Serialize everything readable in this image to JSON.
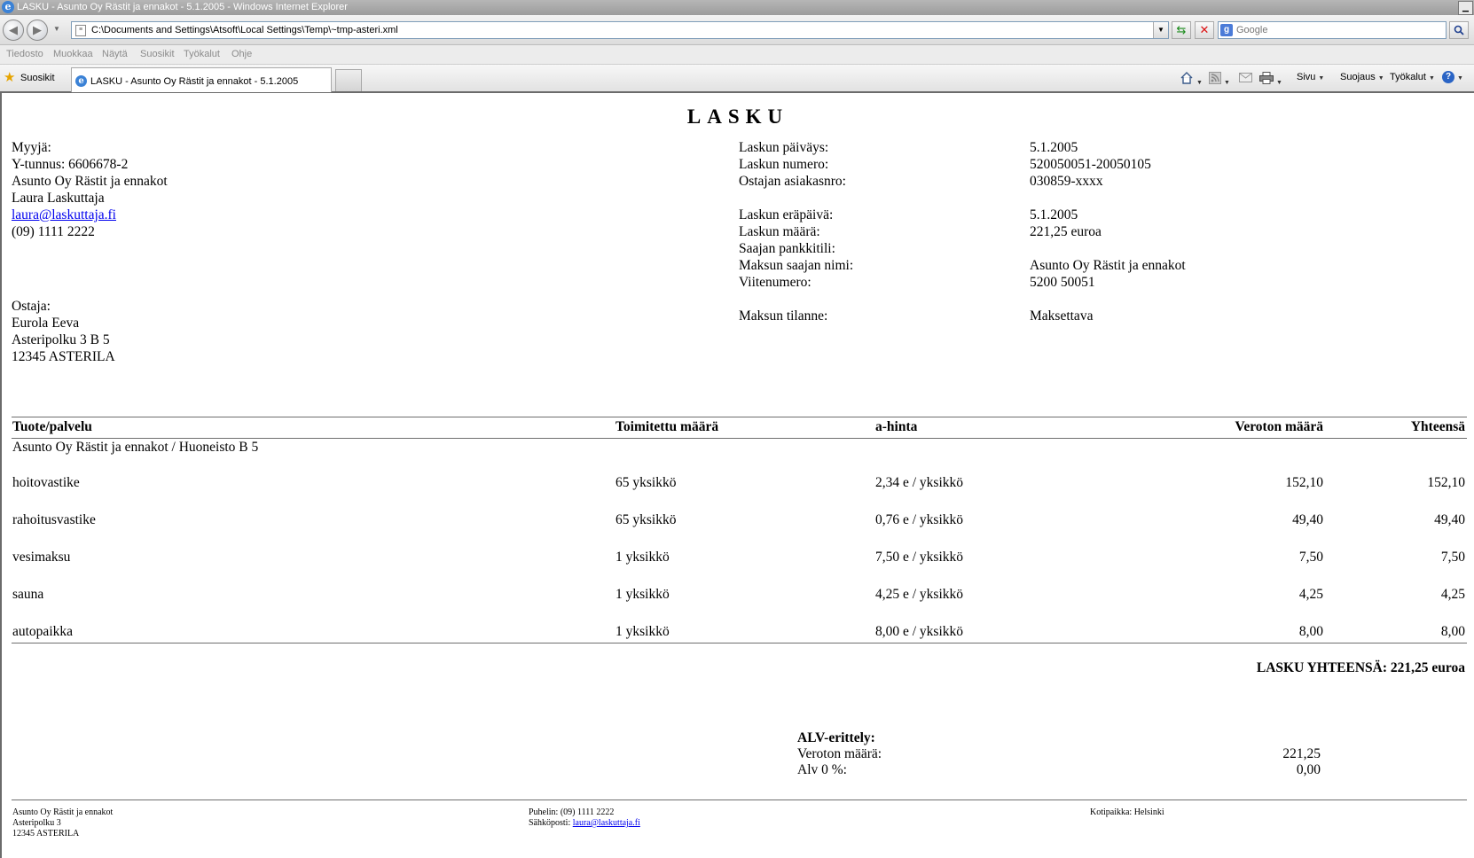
{
  "browser": {
    "window_title": "LASKU - Asunto Oy Rästit ja ennakot - 5.1.2005 - Windows Internet Explorer",
    "address": "C:\\Documents and Settings\\Atsoft\\Local Settings\\Temp\\~tmp-asteri.xml",
    "search_placeholder": "Google",
    "menu": [
      "Tiedosto",
      "Muokkaa",
      "Näytä",
      "Suosikit",
      "Työkalut",
      "Ohje"
    ],
    "favorites_label": "Suosikit",
    "tab_title": "LASKU - Asunto Oy Rästit ja ennakot - 5.1.2005",
    "commands": {
      "page": "Sivu",
      "security": "Suojaus",
      "tools": "Työkalut"
    }
  },
  "invoice": {
    "title": "LASKU",
    "seller": {
      "heading": "Myyjä:",
      "business_id": "Y-tunnus: 6606678-2",
      "company": "Asunto Oy Rästit ja ennakot",
      "person": "Laura Laskuttaja",
      "email": "laura@laskuttaja.fi",
      "phone": "(09) 1111 2222"
    },
    "buyer": {
      "heading": "Ostaja:",
      "name": "Eurola Eeva",
      "street": "Asteripolku 3 B 5",
      "postal": "12345 ASTERILA"
    },
    "details": [
      {
        "label": "Laskun päiväys:",
        "value": "5.1.2005"
      },
      {
        "label": "Laskun numero:",
        "value": "520050051-20050105"
      },
      {
        "label": "Ostajan asiakasnro:",
        "value": "030859-xxxx"
      },
      {
        "label": "Laskun eräpäivä:",
        "value": "5.1.2005"
      },
      {
        "label": "Laskun määrä:",
        "value": "221,25 euroa"
      },
      {
        "label": "Saajan pankkitili:",
        "value": ""
      },
      {
        "label": "Maksun saajan nimi:",
        "value": "Asunto Oy Rästit ja ennakot"
      },
      {
        "label": "Viitenumero:",
        "value": "5200 50051"
      },
      {
        "label": "Maksun tilanne:",
        "value": "Maksettava"
      }
    ],
    "table": {
      "headers": {
        "product": "Tuote/palvelu",
        "quantity": "Toimitettu määrä",
        "unit_price": "a-hinta",
        "net": "Veroton määrä",
        "total": "Yhteensä"
      },
      "group_label": "Asunto Oy Rästit ja ennakot / Huoneisto B 5",
      "rows": [
        {
          "product": "hoitovastike",
          "quantity": "65 yksikkö",
          "unit_price": "2,34 e / yksikkö",
          "net": "152,10",
          "total": "152,10"
        },
        {
          "product": "rahoitusvastike",
          "quantity": "65 yksikkö",
          "unit_price": "0,76 e / yksikkö",
          "net": "49,40",
          "total": "49,40"
        },
        {
          "product": "vesimaksu",
          "quantity": "1 yksikkö",
          "unit_price": "7,50 e / yksikkö",
          "net": "7,50",
          "total": "7,50"
        },
        {
          "product": "sauna",
          "quantity": "1 yksikkö",
          "unit_price": "4,25 e / yksikkö",
          "net": "4,25",
          "total": "4,25"
        },
        {
          "product": "autopaikka",
          "quantity": "1 yksikkö",
          "unit_price": "8,00 e / yksikkö",
          "net": "8,00",
          "total": "8,00"
        }
      ]
    },
    "grand_total": "LASKU YHTEENSÄ: 221,25 euroa",
    "vat": {
      "heading": "ALV-erittely:",
      "net_label": "Veroton määrä:",
      "net_value": "221,25",
      "vat_label": "Alv 0 %:",
      "vat_value": "0,00"
    },
    "footer": {
      "company": "Asunto Oy Rästit ja ennakot",
      "street": "Asteripolku 3",
      "postal": "12345 ASTERILA",
      "phone": "Puhelin: (09) 1111 2222",
      "email_label": "Sähköposti:",
      "email": "laura@laskuttaja.fi",
      "domicile": "Kotipaikka: Helsinki"
    }
  }
}
